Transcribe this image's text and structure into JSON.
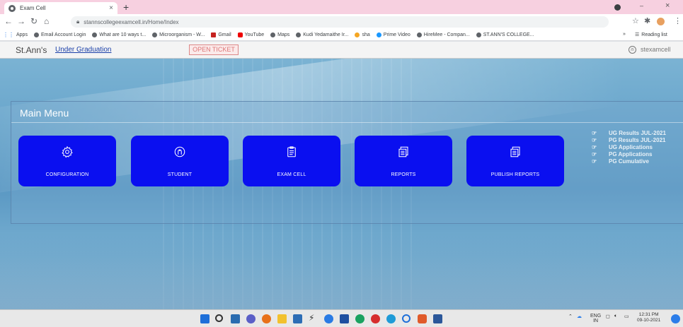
{
  "browser": {
    "tab_title": "Exam Cell",
    "tab_close": "×",
    "new_tab": "+",
    "url": "stannscollegeexamcell.in/Home/Index",
    "window_min": "–",
    "window_close": "×",
    "bookmarks": [
      "Apps",
      "Email Account Login",
      "What are 10 ways t...",
      "Microorganism - W...",
      "Gmail",
      "YouTube",
      "Maps",
      "Kudi Yedamaithe Ir...",
      "sha",
      "Prime Video",
      "HireMee - Compan...",
      "ST.ANN'S COLLEGE..."
    ],
    "reading_list": "Reading list"
  },
  "navbar": {
    "brand": "St.Ann's",
    "link": "Under Graduation",
    "open_ticket": "OPEN TICKET",
    "username": "stexamcell"
  },
  "main_menu": {
    "title": "Main Menu",
    "tiles": [
      {
        "label": "CONFIGURATION",
        "icon": "gear-icon"
      },
      {
        "label": "STUDENT",
        "icon": "user-icon"
      },
      {
        "label": "EXAM CELL",
        "icon": "clipboard-icon"
      },
      {
        "label": "REPORTS",
        "icon": "report-icon"
      },
      {
        "label": "PUBLISH REPORTS",
        "icon": "report-icon"
      }
    ],
    "side_links": [
      "UG Results JUL-2021",
      "PG Results JUL-2021",
      "UG Applications",
      "PG Applications",
      "PG Cumulative"
    ]
  },
  "taskbar": {
    "lang": "ENG",
    "region": "IN",
    "time": "12:31 PM",
    "date": "09-10-2021"
  },
  "colors": {
    "tile_blue": "#0a0ff0",
    "tab_strip": "#f7d0e0",
    "page_blue": "#6aa6cc"
  }
}
